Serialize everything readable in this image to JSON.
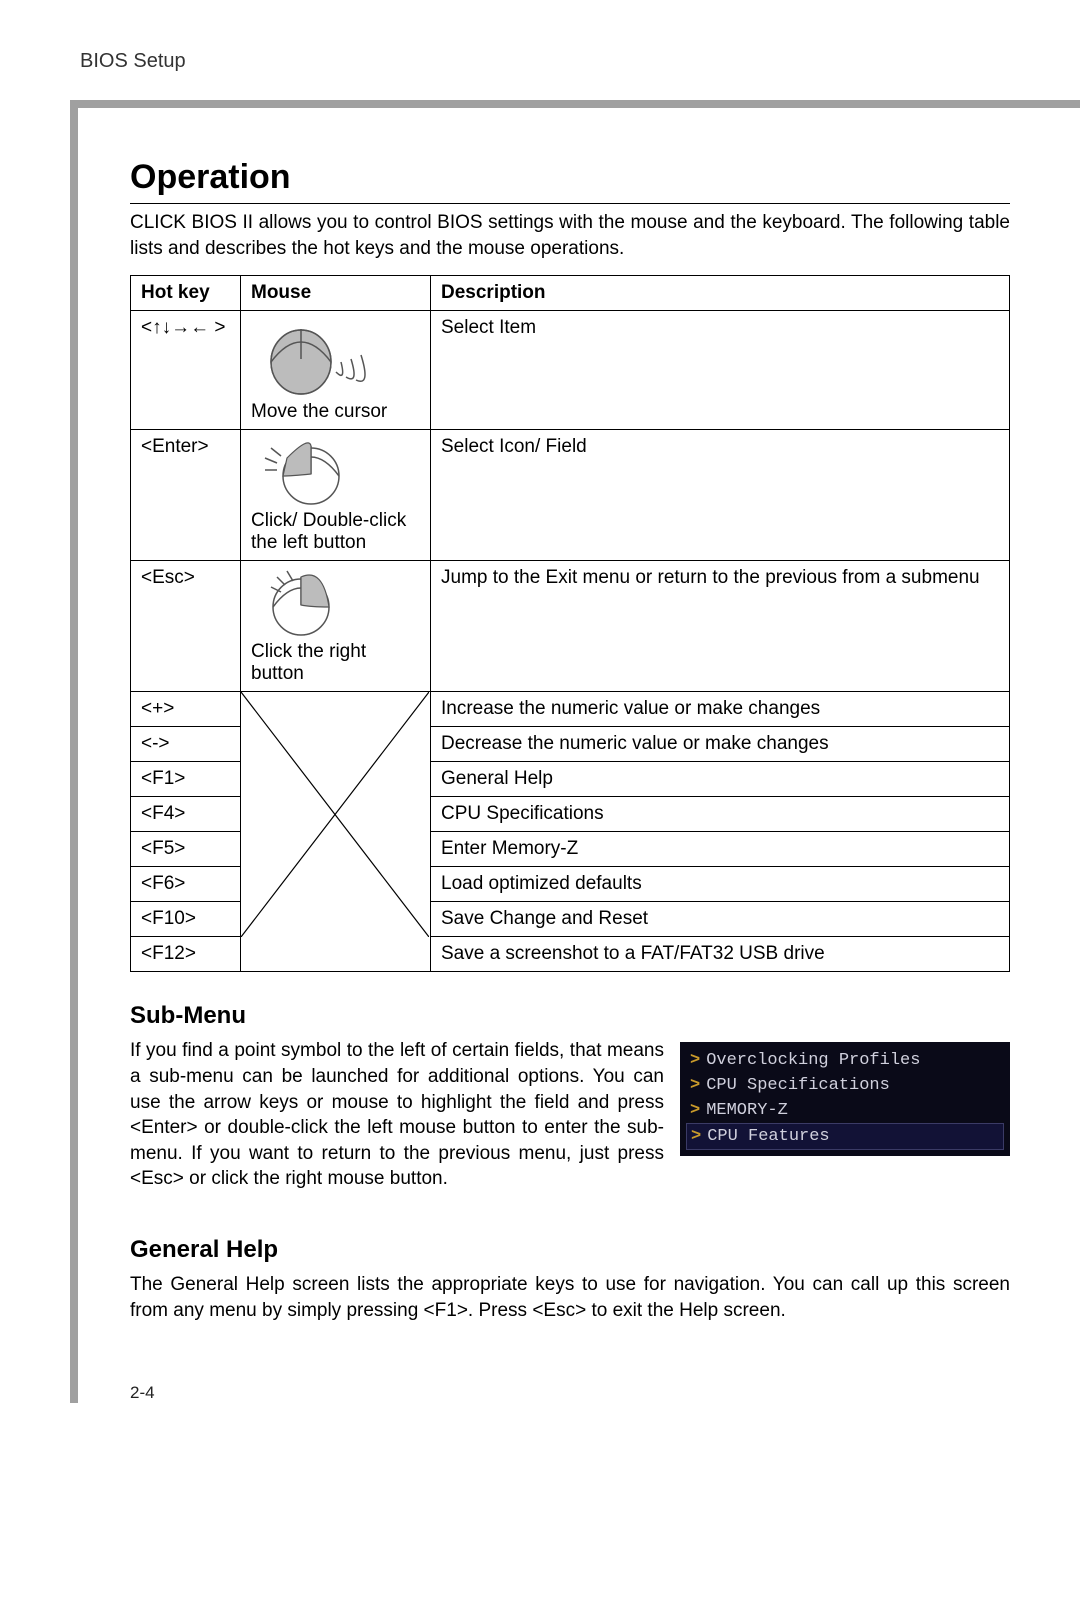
{
  "header": {
    "section": "BIOS Setup"
  },
  "page_number": "2-4",
  "operation": {
    "title": "Operation",
    "intro": "CLICK BIOS II allows you to control BIOS settings with the mouse and the keyboard. The following table lists and describes the hot keys and the mouse operations.",
    "table": {
      "headers": {
        "hotkey": "Hot key",
        "mouse": "Mouse",
        "desc": "Description"
      },
      "rows": [
        {
          "hotkey": "<↑↓→← >",
          "mouse_label": "Move the cursor",
          "desc": "Select Item"
        },
        {
          "hotkey": "<Enter>",
          "mouse_label": "Click/ Double-click the left button",
          "desc": "Select  Icon/ Field"
        },
        {
          "hotkey": "<Esc>",
          "mouse_label": "Click the right button",
          "desc": "Jump to the Exit menu or return to the previous from a submenu"
        },
        {
          "hotkey": "<+>",
          "desc": "Increase the numeric value or make changes"
        },
        {
          "hotkey": "<->",
          "desc": "Decrease the numeric value or make changes"
        },
        {
          "hotkey": "<F1>",
          "desc": "General Help"
        },
        {
          "hotkey": "<F4>",
          "desc": "CPU Specifications"
        },
        {
          "hotkey": "<F5>",
          "desc": "Enter Memory-Z"
        },
        {
          "hotkey": "<F6>",
          "desc": "Load optimized defaults"
        },
        {
          "hotkey": "<F10>",
          "desc": "Save Change and Reset"
        },
        {
          "hotkey": "<F12>",
          "desc": "Save a screenshot to a FAT/FAT32 USB drive"
        }
      ]
    }
  },
  "submenu": {
    "title": "Sub-Menu",
    "body": "If you find a point symbol to the left of certain fields, that means a sub-menu can be launched for additional options. You can use the arrow keys or mouse to highlight the field and press <Enter> or double-click the left mouse button to enter the sub-menu. If you want to return to the previous menu, just press <Esc> or click the right mouse button.",
    "items": [
      {
        "label": "Overclocking Profiles",
        "highlight": false
      },
      {
        "label": "CPU Specifications",
        "highlight": false
      },
      {
        "label": "MEMORY-Z",
        "highlight": false
      },
      {
        "label": "CPU Features",
        "highlight": true
      }
    ]
  },
  "general_help": {
    "title": "General Help",
    "body": "The General Help screen lists the appropriate keys to use for navigation. You can call up this screen from any menu by simply pressing <F1>. Press <Esc> to exit the Help screen."
  }
}
